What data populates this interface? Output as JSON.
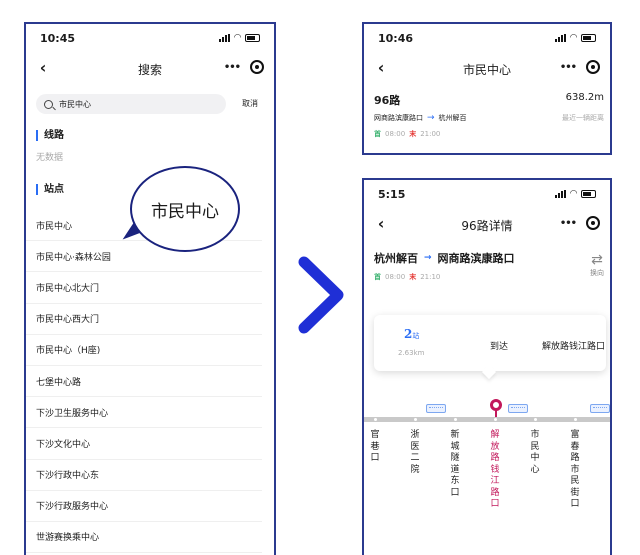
{
  "search_screen": {
    "time": "10:45",
    "title": "搜索",
    "search_value": "市民中心",
    "cancel_label": "取消",
    "routes_header": "线路",
    "routes_empty": "无数据",
    "stops_header": "站点",
    "stops": [
      "市民中心",
      "市民中心·森林公园",
      "市民中心北大门",
      "市民中心西大门",
      "市民中心（H座)",
      "七堡中心路",
      "下沙卫生服务中心",
      "下沙文化中心",
      "下沙行政中心东",
      "下沙行政服务中心",
      "世游赛换乘中心"
    ],
    "bubble_text": "市民中心"
  },
  "result_screen": {
    "time": "10:46",
    "title": "市民中心",
    "route_name": "96路",
    "distance": "638.2m",
    "from": "网商路滨康路口",
    "to": "杭州解百",
    "hint": "最近一辆距离",
    "first_tag": "首",
    "first_time": "08:00",
    "last_tag": "末",
    "last_time": "21:00"
  },
  "detail_screen": {
    "time": "5:15",
    "title": "96路详情",
    "from": "杭州解百",
    "to": "网商路滨康路口",
    "swap_label": "换向",
    "first_tag": "首",
    "first_time": "08:00",
    "last_tag": "末",
    "last_time": "21:10",
    "stations_away": "2",
    "stations_unit": "站",
    "distance": "2.63km",
    "arrive_label": "到达",
    "station_name": "解放路钱江路口",
    "stations": [
      "官巷口",
      "浙医二院",
      "新城隧道东口",
      "解放路钱江路口",
      "市民中心",
      "富春路市民街口"
    ]
  },
  "colors": {
    "accent": "#2a6df4",
    "active_station": "#c2185b",
    "frame": "#2b3a8f",
    "arrow": "#1f2fd6"
  }
}
